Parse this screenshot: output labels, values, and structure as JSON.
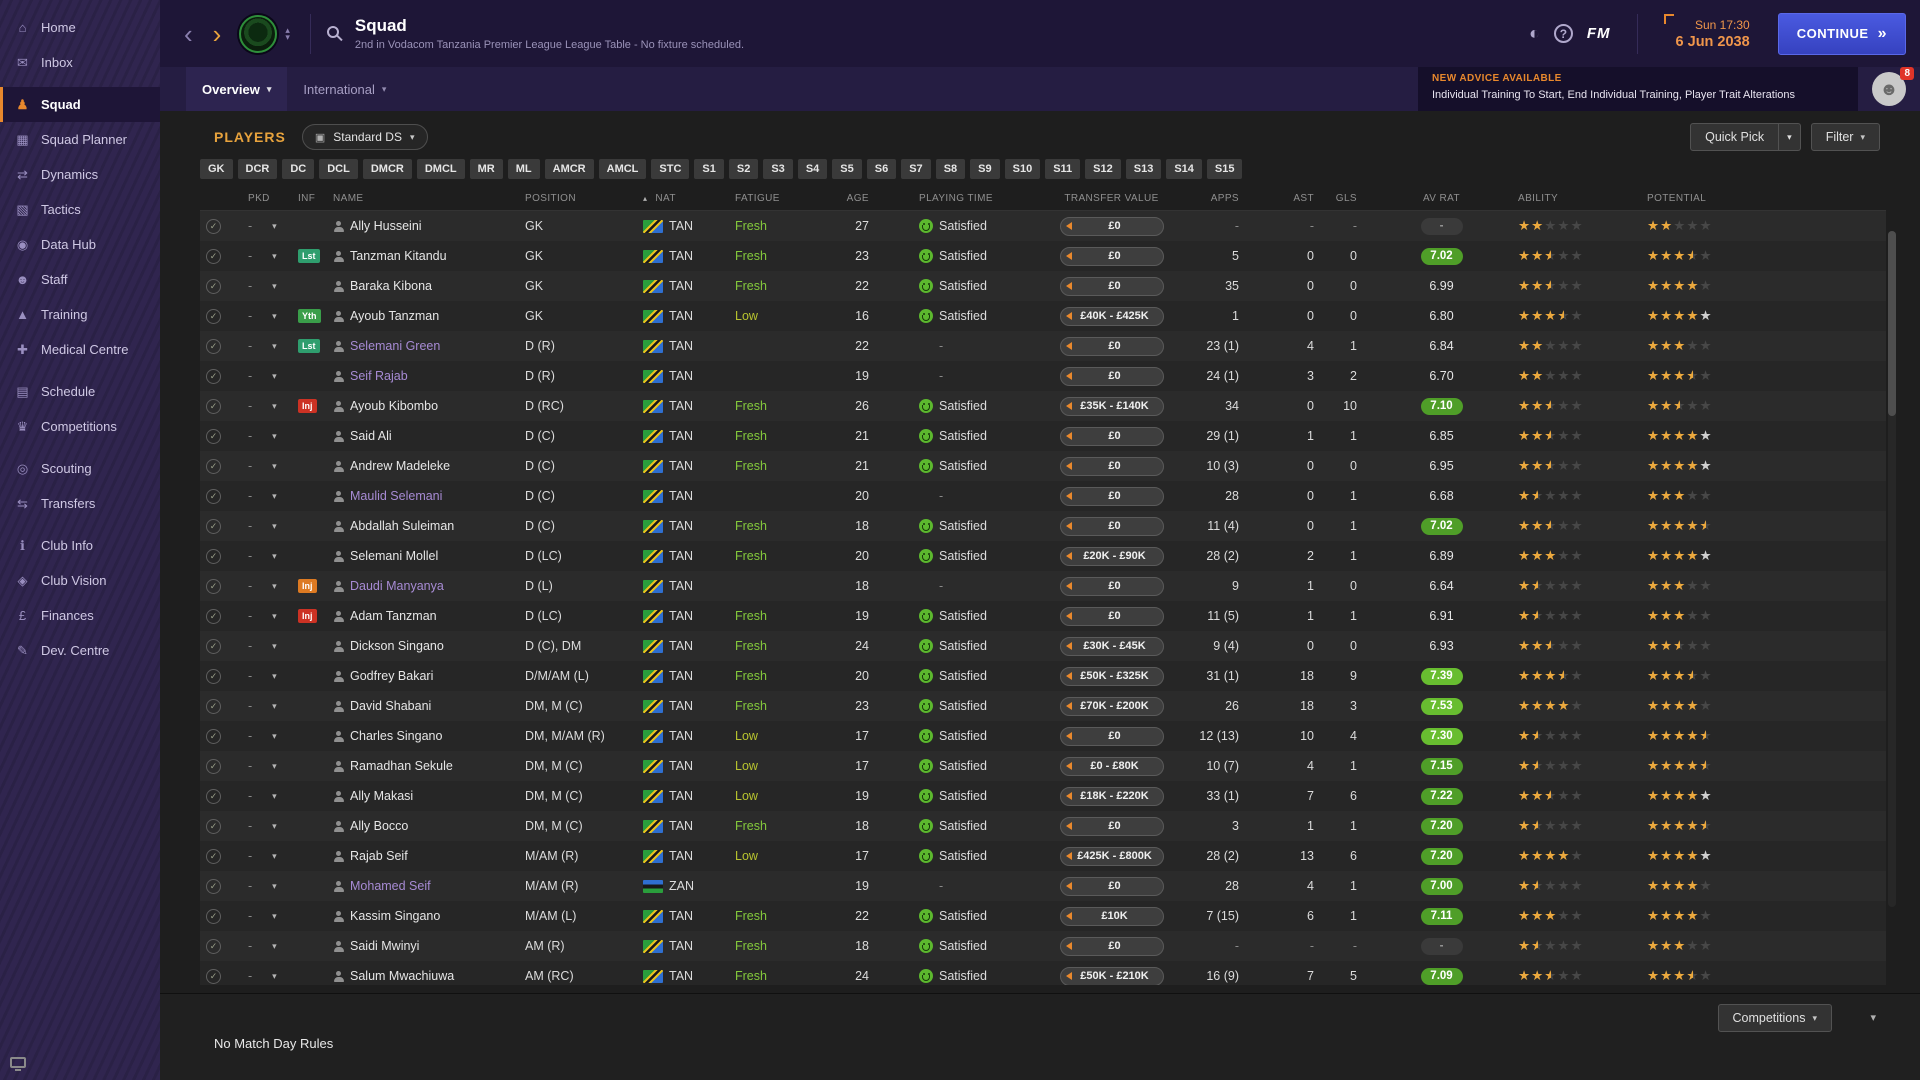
{
  "sidebar": {
    "items": [
      {
        "label": "Home",
        "icon": "home-icon"
      },
      {
        "label": "Inbox",
        "icon": "inbox-icon"
      },
      {
        "label": "Squad",
        "icon": "squad-icon",
        "active": true,
        "group": true
      },
      {
        "label": "Squad Planner",
        "icon": "squad-planner-icon"
      },
      {
        "label": "Dynamics",
        "icon": "dynamics-icon"
      },
      {
        "label": "Tactics",
        "icon": "tactics-icon"
      },
      {
        "label": "Data Hub",
        "icon": "data-hub-icon"
      },
      {
        "label": "Staff",
        "icon": "staff-icon"
      },
      {
        "label": "Training",
        "icon": "training-icon"
      },
      {
        "label": "Medical Centre",
        "icon": "medical-icon"
      },
      {
        "label": "Schedule",
        "icon": "schedule-icon",
        "group": true
      },
      {
        "label": "Competitions",
        "icon": "competitions-icon"
      },
      {
        "label": "Scouting",
        "icon": "scouting-icon",
        "group": true
      },
      {
        "label": "Transfers",
        "icon": "transfers-icon"
      },
      {
        "label": "Club Info",
        "icon": "club-info-icon",
        "group": true
      },
      {
        "label": "Club Vision",
        "icon": "club-vision-icon"
      },
      {
        "label": "Finances",
        "icon": "finances-icon"
      },
      {
        "label": "Dev. Centre",
        "icon": "dev-centre-icon"
      }
    ]
  },
  "topbar": {
    "title": "Squad",
    "subtitle": "2nd in Vodacom Tanzania Premier League League Table - No fixture scheduled.",
    "fm_logo": "FM",
    "time": "Sun 17:30",
    "date": "6 Jun 2038",
    "continue_label": "CONTINUE"
  },
  "tabs": {
    "overview": "Overview",
    "international": "International"
  },
  "advice": {
    "heading": "NEW ADVICE AVAILABLE",
    "text": "Individual Training To Start, End Individual Training, Player Trait Alterations",
    "badge_count": "8"
  },
  "toolbar": {
    "players_label": "PLAYERS",
    "view_selector": "Standard DS",
    "quick_pick": "Quick Pick",
    "filter": "Filter"
  },
  "position_chips": [
    "GK",
    "DCR",
    "DC",
    "DCL",
    "DMCR",
    "DMCL",
    "MR",
    "ML",
    "AMCR",
    "AMCL",
    "STC",
    "S1",
    "S2",
    "S3",
    "S4",
    "S5",
    "S6",
    "S7",
    "S8",
    "S9",
    "S10",
    "S11",
    "S12",
    "S13",
    "S14",
    "S15"
  ],
  "table": {
    "columns": [
      "PKD",
      "INF",
      "NAME",
      "POSITION",
      "NAT",
      "FATIGUE",
      "AGE",
      "PLAYING TIME",
      "TRANSFER VALUE",
      "APPS",
      "AST",
      "GLS",
      "AV RAT",
      "ABILITY",
      "POTENTIAL"
    ],
    "rows": [
      {
        "pkd": "-",
        "inf": "",
        "name": "Ally Husseini",
        "pos": "GK",
        "nat": "TAN",
        "fatigue": "Fresh",
        "age": 27,
        "pt": "Satisfied",
        "tv": "£0",
        "apps": "-",
        "ast": "-",
        "gls": "-",
        "av": "-",
        "ab": 2,
        "po": 2
      },
      {
        "pkd": "-",
        "inf": "Lst",
        "inf_style": "listed",
        "name": "Tanzman Kitandu",
        "pos": "GK",
        "nat": "TAN",
        "fatigue": "Fresh",
        "age": 23,
        "pt": "Satisfied",
        "tv": "£0",
        "apps": "5",
        "ast": "0",
        "gls": "0",
        "av": "7.02",
        "ab": 2.5,
        "po": 3.5
      },
      {
        "pkd": "-",
        "inf": "",
        "name": "Baraka Kibona",
        "pos": "GK",
        "nat": "TAN",
        "fatigue": "Fresh",
        "age": 22,
        "pt": "Satisfied",
        "tv": "£0",
        "apps": "35",
        "ast": "0",
        "gls": "0",
        "av": "6.99",
        "ab": 2.5,
        "po": 4
      },
      {
        "pkd": "-",
        "inf": "Yth",
        "inf_style": "youth",
        "name": "Ayoub Tanzman",
        "pos": "GK",
        "nat": "TAN",
        "fatigue": "Low",
        "age": 16,
        "pt": "Satisfied",
        "tv": "£40K - £425K",
        "apps": "1",
        "ast": "0",
        "gls": "0",
        "av": "6.80",
        "ab": 3.5,
        "po": 4,
        "ps": 1
      },
      {
        "pkd": "-",
        "inf": "Lst",
        "inf_style": "listed",
        "name": "Selemani Green",
        "purple": true,
        "pos": "D (R)",
        "nat": "TAN",
        "fatigue": "",
        "age": 22,
        "pt": "-",
        "tv": "£0",
        "apps": "23 (1)",
        "ast": "4",
        "gls": "1",
        "av": "6.84",
        "ab": 2,
        "po": 3
      },
      {
        "pkd": "-",
        "inf": "",
        "name": "Seif Rajab",
        "purple": true,
        "pos": "D (R)",
        "nat": "TAN",
        "fatigue": "",
        "age": 19,
        "pt": "-",
        "tv": "£0",
        "apps": "24 (1)",
        "ast": "3",
        "gls": "2",
        "av": "6.70",
        "ab": 2,
        "po": 3.5
      },
      {
        "pkd": "-",
        "inf": "Inj",
        "inf_style": "inj-red",
        "name": "Ayoub Kibombo",
        "pos": "D (RC)",
        "nat": "TAN",
        "fatigue": "Fresh",
        "age": 26,
        "pt": "Satisfied",
        "tv": "£35K - £140K",
        "apps": "34",
        "ast": "0",
        "gls": "10",
        "av": "7.10",
        "ab": 2.5,
        "po": 2.5
      },
      {
        "pkd": "-",
        "inf": "",
        "name": "Said Ali",
        "pos": "D (C)",
        "nat": "TAN",
        "fatigue": "Fresh",
        "age": 21,
        "pt": "Satisfied",
        "tv": "£0",
        "apps": "29 (1)",
        "ast": "1",
        "gls": "1",
        "av": "6.85",
        "ab": 2.5,
        "po": 4,
        "ps": 1
      },
      {
        "pkd": "-",
        "inf": "",
        "name": "Andrew Madeleke",
        "pos": "D (C)",
        "nat": "TAN",
        "fatigue": "Fresh",
        "age": 21,
        "pt": "Satisfied",
        "tv": "£0",
        "apps": "10 (3)",
        "ast": "0",
        "gls": "0",
        "av": "6.95",
        "ab": 2.5,
        "po": 4,
        "ps": 1
      },
      {
        "pkd": "-",
        "inf": "",
        "name": "Maulid Selemani",
        "purple": true,
        "pos": "D (C)",
        "nat": "TAN",
        "fatigue": "",
        "age": 20,
        "pt": "-",
        "tv": "£0",
        "apps": "28",
        "ast": "0",
        "gls": "1",
        "av": "6.68",
        "ab": 1.5,
        "po": 3
      },
      {
        "pkd": "-",
        "inf": "",
        "name": "Abdallah Suleiman",
        "pos": "D (C)",
        "nat": "TAN",
        "fatigue": "Fresh",
        "age": 18,
        "pt": "Satisfied",
        "tv": "£0",
        "apps": "11 (4)",
        "ast": "0",
        "gls": "1",
        "av": "7.02",
        "ab": 2.5,
        "po": 4.5
      },
      {
        "pkd": "-",
        "inf": "",
        "name": "Selemani Mollel",
        "pos": "D (LC)",
        "nat": "TAN",
        "fatigue": "Fresh",
        "age": 20,
        "pt": "Satisfied",
        "tv": "£20K - £90K",
        "apps": "28 (2)",
        "ast": "2",
        "gls": "1",
        "av": "6.89",
        "ab": 3,
        "po": 4,
        "ps": 1
      },
      {
        "pkd": "-",
        "inf": "Inj",
        "inf_style": "inj-orange",
        "name": "Daudi Manyanya",
        "purple": true,
        "pos": "D (L)",
        "nat": "TAN",
        "fatigue": "",
        "age": 18,
        "pt": "-",
        "tv": "£0",
        "apps": "9",
        "ast": "1",
        "gls": "0",
        "av": "6.64",
        "ab": 1.5,
        "po": 3
      },
      {
        "pkd": "-",
        "inf": "Inj",
        "inf_style": "inj-red",
        "name": "Adam Tanzman",
        "pos": "D (LC)",
        "nat": "TAN",
        "fatigue": "Fresh",
        "age": 19,
        "pt": "Satisfied",
        "tv": "£0",
        "apps": "11 (5)",
        "ast": "1",
        "gls": "1",
        "av": "6.91",
        "ab": 1.5,
        "po": 3
      },
      {
        "pkd": "-",
        "inf": "",
        "name": "Dickson Singano",
        "pos": "D (C), DM",
        "nat": "TAN",
        "fatigue": "Fresh",
        "age": 24,
        "pt": "Satisfied",
        "tv": "£30K - £45K",
        "apps": "9 (4)",
        "ast": "0",
        "gls": "0",
        "av": "6.93",
        "ab": 2.5,
        "po": 2.5
      },
      {
        "pkd": "-",
        "inf": "",
        "name": "Godfrey Bakari",
        "pos": "D/M/AM (L)",
        "nat": "TAN",
        "fatigue": "Fresh",
        "age": 20,
        "pt": "Satisfied",
        "tv": "£50K - £325K",
        "apps": "31 (1)",
        "ast": "18",
        "gls": "9",
        "av": "7.39",
        "ab": 3.5,
        "po": 3.5
      },
      {
        "pkd": "-",
        "inf": "",
        "name": "David Shabani",
        "pos": "DM, M (C)",
        "nat": "TAN",
        "fatigue": "Fresh",
        "age": 23,
        "pt": "Satisfied",
        "tv": "£70K - £200K",
        "apps": "26",
        "ast": "18",
        "gls": "3",
        "av": "7.53",
        "ab": 4,
        "po": 4
      },
      {
        "pkd": "-",
        "inf": "",
        "name": "Charles Singano",
        "pos": "DM, M/AM (R)",
        "nat": "TAN",
        "fatigue": "Low",
        "age": 17,
        "pt": "Satisfied",
        "tv": "£0",
        "apps": "12 (13)",
        "ast": "10",
        "gls": "4",
        "av": "7.30",
        "ab": 1.5,
        "po": 4.5
      },
      {
        "pkd": "-",
        "inf": "",
        "name": "Ramadhan Sekule",
        "pos": "DM, M (C)",
        "nat": "TAN",
        "fatigue": "Low",
        "age": 17,
        "pt": "Satisfied",
        "tv": "£0 - £80K",
        "apps": "10 (7)",
        "ast": "4",
        "gls": "1",
        "av": "7.15",
        "ab": 1.5,
        "po": 4.5
      },
      {
        "pkd": "-",
        "inf": "",
        "name": "Ally Makasi",
        "pos": "DM, M (C)",
        "nat": "TAN",
        "fatigue": "Low",
        "age": 19,
        "pt": "Satisfied",
        "tv": "£18K - £220K",
        "apps": "33 (1)",
        "ast": "7",
        "gls": "6",
        "av": "7.22",
        "ab": 2.5,
        "po": 4,
        "ps": 1
      },
      {
        "pkd": "-",
        "inf": "",
        "name": "Ally Bocco",
        "pos": "DM, M (C)",
        "nat": "TAN",
        "fatigue": "Fresh",
        "age": 18,
        "pt": "Satisfied",
        "tv": "£0",
        "apps": "3",
        "ast": "1",
        "gls": "1",
        "av": "7.20",
        "ab": 1.5,
        "po": 4.5
      },
      {
        "pkd": "-",
        "inf": "",
        "name": "Rajab Seif",
        "pos": "M/AM (R)",
        "nat": "TAN",
        "fatigue": "Low",
        "age": 17,
        "pt": "Satisfied",
        "tv": "£425K - £800K",
        "apps": "28 (2)",
        "ast": "13",
        "gls": "6",
        "av": "7.20",
        "ab": 4,
        "po": 4,
        "ps": 1
      },
      {
        "pkd": "-",
        "inf": "",
        "name": "Mohamed Seif",
        "purple": true,
        "pos": "M/AM (R)",
        "nat": "ZAN",
        "fatigue": "",
        "age": 19,
        "pt": "-",
        "tv": "£0",
        "apps": "28",
        "ast": "4",
        "gls": "1",
        "av": "7.00",
        "ab": 1.5,
        "po": 4
      },
      {
        "pkd": "-",
        "inf": "",
        "name": "Kassim Singano",
        "pos": "M/AM (L)",
        "nat": "TAN",
        "fatigue": "Fresh",
        "age": 22,
        "pt": "Satisfied",
        "tv": "£10K",
        "apps": "7 (15)",
        "ast": "6",
        "gls": "1",
        "av": "7.11",
        "ab": 3,
        "po": 4
      },
      {
        "pkd": "-",
        "inf": "",
        "name": "Saidi Mwinyi",
        "pos": "AM (R)",
        "nat": "TAN",
        "fatigue": "Fresh",
        "age": 18,
        "pt": "Satisfied",
        "tv": "£0",
        "apps": "-",
        "ast": "-",
        "gls": "-",
        "av": "-",
        "ab": 1.5,
        "po": 3
      },
      {
        "pkd": "-",
        "inf": "",
        "name": "Salum Mwachiuwa",
        "pos": "AM (RC)",
        "nat": "TAN",
        "fatigue": "Fresh",
        "age": 24,
        "pt": "Satisfied",
        "tv": "£50K - £210K",
        "apps": "16 (9)",
        "ast": "7",
        "gls": "5",
        "av": "7.09",
        "ab": 2.5,
        "po": 3.5
      }
    ]
  },
  "footer": {
    "status": "No Match Day Rules",
    "competitions_label": "Competitions"
  }
}
